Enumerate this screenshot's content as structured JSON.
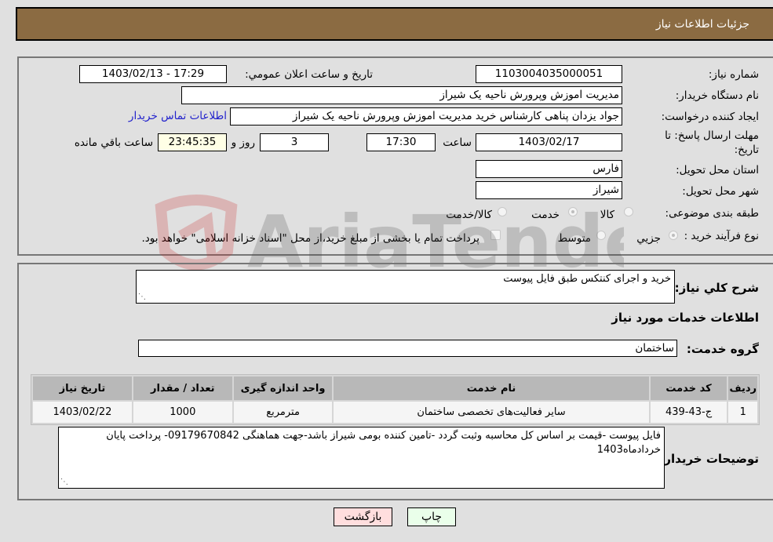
{
  "header": {
    "title": "جزئیات اطلاعات نیاز"
  },
  "form": {
    "need_number": {
      "label": "شماره نیاز:",
      "value": "1103004035000051"
    },
    "announce_datetime": {
      "label": "تاریخ و ساعت اعلان عمومي:",
      "value": "1403/02/13 - 17:29"
    },
    "buyer_org": {
      "label": "نام دستگاه خریدار:",
      "value": "مدیریت اموزش وپرورش ناحیه یک شیراز"
    },
    "requester": {
      "label": "ایجاد کننده درخواست:",
      "value": "جواد یزدان پناهی کارشناس خرید مدیریت اموزش وپرورش ناحیه یک شیراز"
    },
    "buyer_contact_link": "اطلاعات تماس خریدار",
    "deadline": {
      "label": "مهلت ارسال پاسخ: تا تاریخ:",
      "date": "1403/02/17",
      "time_label": "ساعت",
      "time": "17:30",
      "days": "3",
      "days_label": "روز و",
      "remaining": "23:45:35",
      "remaining_label": "ساعت باقي مانده"
    },
    "province": {
      "label": "استان محل تحویل:",
      "value": "فارس"
    },
    "city": {
      "label": "شهر محل تحویل:",
      "value": "شیراز"
    },
    "category": {
      "label": "طبقه بندی موضوعی:",
      "options": [
        "کالا",
        "خدمت",
        "کالا/خدمت"
      ],
      "selected": "خدمت"
    },
    "purchase_type": {
      "label": "نوع فرآیند خرید :",
      "options": [
        "جزيي",
        "متوسط"
      ],
      "selected": "جزيي",
      "treasury_note": "پرداخت تمام یا بخشی از مبلغ خرید،از محل \"اسناد خزانه اسلامی\" خواهد بود."
    }
  },
  "details": {
    "general_desc_label": "شرح کلي نیاز:",
    "general_desc": "خرید و اجرای کنتکس طبق فایل پیوست",
    "services_heading": "اطلاعات خدمات مورد نیاز",
    "service_group_label": "گروه خدمت:",
    "service_group": "ساختمان",
    "table": {
      "headers": [
        "ردیف",
        "کد خدمت",
        "نام خدمت",
        "واحد اندازه گیری",
        "تعداد / مقدار",
        "تاریخ نیاز"
      ],
      "rows": [
        [
          "1",
          "ج-43-439",
          "سایر فعالیت‌های تخصصی ساختمان",
          "مترمربع",
          "1000",
          "1403/02/22"
        ]
      ]
    },
    "buyer_notes_label": "توضیحات خریدار:",
    "buyer_notes": "فایل پیوست -قیمت بر اساس کل محاسبه وثبت گردد -تامین کننده بومی شیراز باشد-جهت هماهنگی 09179670842- پرداخت پایان خردادماه1403"
  },
  "buttons": {
    "print": "چاپ",
    "back": "بازگشت"
  },
  "colors": {
    "header_bg": "#8b6b42",
    "print_bg": "#eaffea",
    "back_bg": "#ffdede",
    "link": "#2222cc"
  },
  "watermark": "AriaTender.neT"
}
